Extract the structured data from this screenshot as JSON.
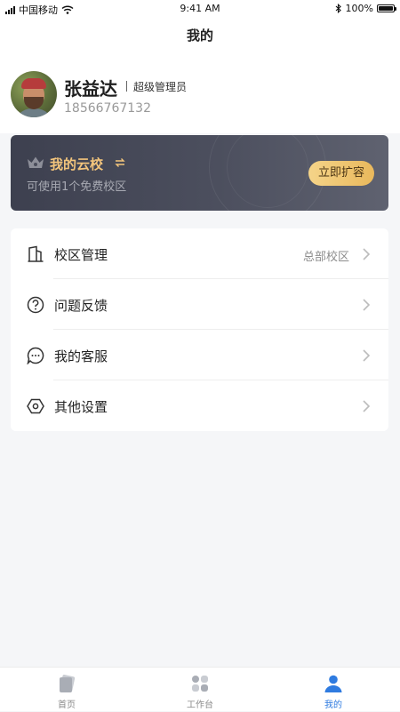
{
  "status_bar": {
    "carrier": "中国移动",
    "time": "9:41 AM",
    "battery": "100%"
  },
  "nav": {
    "title": "我的"
  },
  "profile": {
    "name": "张益达",
    "role": "超级管理员",
    "phone": "18566767132"
  },
  "cloud_card": {
    "title": "我的云校",
    "subtitle": "可使用1个免费校区",
    "button": "立即扩容",
    "accent_color": "#f3c57c"
  },
  "menu": {
    "items": [
      {
        "label": "校区管理",
        "value": "总部校区",
        "icon": "building-icon"
      },
      {
        "label": "问题反馈",
        "value": "",
        "icon": "question-circle-icon"
      },
      {
        "label": "我的客服",
        "value": "",
        "icon": "chat-bubble-icon"
      },
      {
        "label": "其他设置",
        "value": "",
        "icon": "settings-hexagon-icon"
      }
    ]
  },
  "tab_bar": {
    "tabs": [
      {
        "label": "首页",
        "icon": "home-cards-icon",
        "active": false
      },
      {
        "label": "工作台",
        "icon": "workbench-grid-icon",
        "active": false
      },
      {
        "label": "我的",
        "icon": "person-icon",
        "active": true
      }
    ],
    "active_color": "#2f7be0"
  }
}
